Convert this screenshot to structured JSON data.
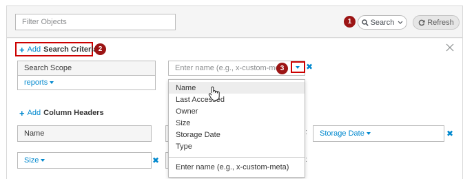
{
  "toolbar": {
    "filter_placeholder": "Filter Objects",
    "search_label": "Search",
    "refresh_label": "Refresh",
    "badge1": "1"
  },
  "criteria": {
    "add_word": "Add",
    "add_strong": "Search Criteria",
    "badge2": "2",
    "scope_label": "Search Scope",
    "scope_value": "reports",
    "name_placeholder": "Enter name (e.g., x-custom-meta)",
    "badge3": "3"
  },
  "columns": {
    "add_word": "Add",
    "add_strong": "Column Headers",
    "col1_label": "Name",
    "col_storage_value": "Storage Date",
    "col_size_value": "Size"
  },
  "dropdown": {
    "items": [
      "Name",
      "Last Accessed",
      "Owner",
      "Size",
      "Storage Date",
      "Type"
    ],
    "custom_item": "Enter name (e.g., x-custom-meta)"
  },
  "colors": {
    "accent": "#0088ce",
    "badge": "#9c1515",
    "highlight": "#cc0000"
  }
}
